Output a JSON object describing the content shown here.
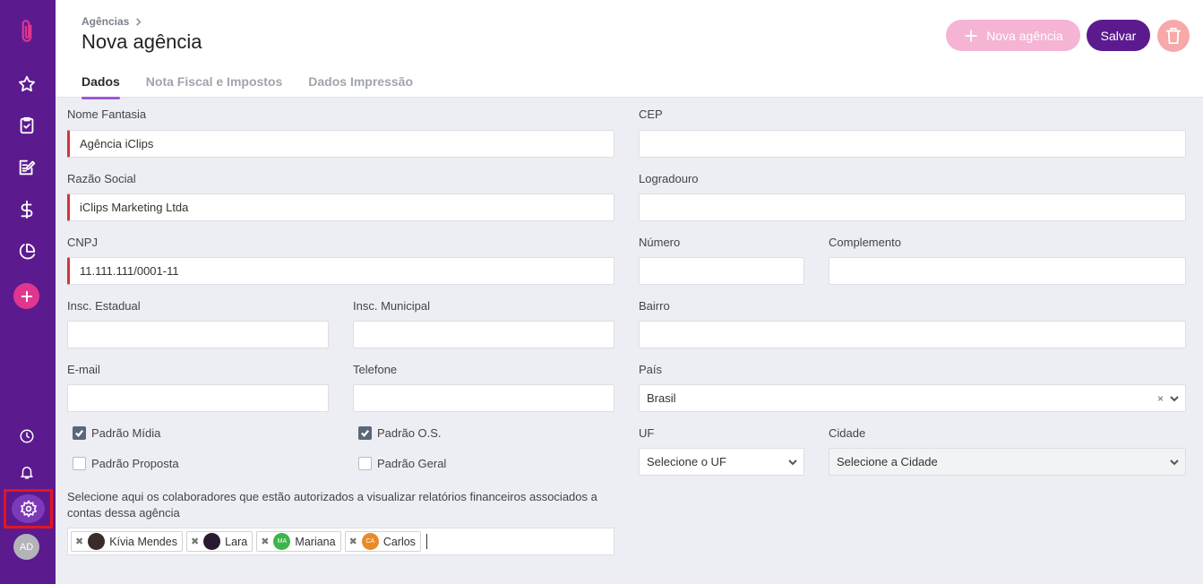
{
  "header": {
    "breadcrumb": "Agências",
    "title": "Nova agência",
    "new_button": "Nova agência",
    "save_button": "Salvar"
  },
  "tabs": [
    "Dados",
    "Nota Fiscal e Impostos",
    "Dados Impressão"
  ],
  "sidebar": {
    "avatar_initials": "AD",
    "icons": [
      "clip-logo-icon",
      "star-icon",
      "clipboard-check-icon",
      "edit-note-icon",
      "dollar-icon",
      "pie-chart-icon",
      "plus-icon",
      "clock-icon",
      "bell-icon",
      "settings-icon"
    ]
  },
  "form": {
    "nome_fantasia": {
      "label": "Nome Fantasia",
      "value": "Agência iClips"
    },
    "razao_social": {
      "label": "Razão Social",
      "value": "iClips Marketing Ltda"
    },
    "cnpj": {
      "label": "CNPJ",
      "value": "11.111.111/0001-11"
    },
    "insc_estadual": {
      "label": "Insc. Estadual",
      "value": ""
    },
    "insc_municipal": {
      "label": "Insc. Municipal",
      "value": ""
    },
    "email": {
      "label": "E-mail",
      "value": ""
    },
    "telefone": {
      "label": "Telefone",
      "value": ""
    },
    "cep": {
      "label": "CEP",
      "value": ""
    },
    "logradouro": {
      "label": "Logradouro",
      "value": ""
    },
    "numero": {
      "label": "Número",
      "value": ""
    },
    "complemento": {
      "label": "Complemento",
      "value": ""
    },
    "bairro": {
      "label": "Bairro",
      "value": ""
    },
    "pais": {
      "label": "País",
      "value": "Brasil"
    },
    "uf": {
      "label": "UF",
      "value": "Selecione o UF"
    },
    "cidade": {
      "label": "Cidade",
      "value": "Selecione a Cidade"
    },
    "checks": {
      "padrao_midia": {
        "label": "Padrão Mídia",
        "checked": true
      },
      "padrao_os": {
        "label": "Padrão O.S.",
        "checked": true
      },
      "padrao_proposta": {
        "label": "Padrão Proposta",
        "checked": false
      },
      "padrao_geral": {
        "label": "Padrão Geral",
        "checked": false
      }
    },
    "colaboradores_label": "Selecione aqui os colaboradores que estão autorizados a visualizar relatórios financeiros associados a contas dessa agência",
    "colaboradores": [
      {
        "name": "Kívia Mendes",
        "initials": "",
        "color": "#3a2a2a"
      },
      {
        "name": "Lara",
        "initials": "",
        "color": "#2a1a30"
      },
      {
        "name": "Mariana",
        "initials": "MA",
        "color": "#3cb54a"
      },
      {
        "name": "Carlos",
        "initials": "CA",
        "color": "#e98a2a"
      }
    ]
  },
  "colors": {
    "sidebar": "#5c1a8f",
    "accent_pink": "#e0368f",
    "required_marker": "#d6333f"
  }
}
